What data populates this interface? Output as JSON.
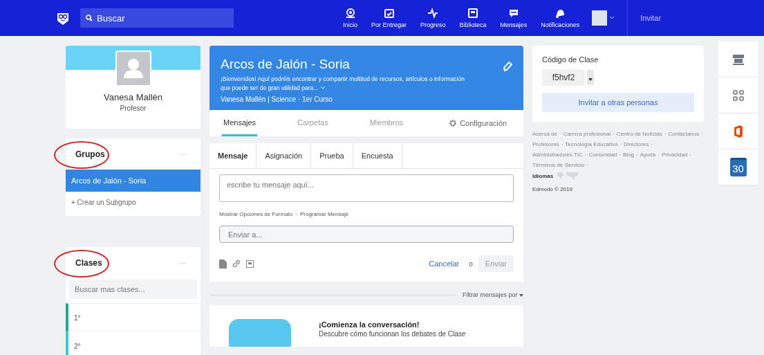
{
  "topbar": {
    "search_placeholder": "Buscar",
    "nav": [
      {
        "label": "Inicio"
      },
      {
        "label": "Por Entregar"
      },
      {
        "label": "Progreso"
      },
      {
        "label": "Biblioteca"
      },
      {
        "label": "Mensajes"
      },
      {
        "label": "Notificaciones"
      }
    ],
    "invite": "Invitar"
  },
  "profile": {
    "name": "Vanesa Mallén",
    "role": "Profesor"
  },
  "groups": {
    "title": "Grupos",
    "more": "···",
    "items": [
      {
        "label": "Arcos de Jalón - Soria",
        "selected": true
      }
    ],
    "create": "+ Crear un Subgrupo"
  },
  "classes": {
    "title": "Clases",
    "more": "···",
    "search_placeholder": "Buscar mas clases...",
    "items": [
      {
        "label": "1°",
        "color": "#2ba58a"
      },
      {
        "label": "2°",
        "color": "#3cc4dc"
      }
    ]
  },
  "group_header": {
    "title": "Arcos de Jalón - Soria",
    "description": "¡Bienvenidos! Aquí podréis encontrar y compartir multitud de recursos, artículos o información que puede ser de gran utilidad para...",
    "meta": "Vanesa Mallén | Science · 1er Curso"
  },
  "group_tabs": [
    {
      "label": "Mensajes",
      "selected": true
    },
    {
      "label": "Carpetas",
      "selected": false
    },
    {
      "label": "Miembros",
      "selected": false
    }
  ],
  "settings": "Configuración",
  "composer": {
    "tabs": [
      {
        "label": "Mensaje",
        "selected": true
      },
      {
        "label": "Asignación",
        "selected": false
      },
      {
        "label": "Prueba",
        "selected": false
      },
      {
        "label": "Encuesta",
        "selected": false
      }
    ],
    "message_placeholder": "escribe tu mensaje aquí...",
    "options": [
      "Mostrar Opciones de Formato",
      "Programar Mensaje"
    ],
    "separator": "·",
    "send_to_placeholder": "Enviar a...",
    "cancel": "Cancelar",
    "or": "o",
    "send": {
      "label": "Enviar",
      "disabled": true
    }
  },
  "filter": "Filtrar mensajes por",
  "empty_state": {
    "title": "¡Comienza la conversación!",
    "text": "Descubre cómo funcionan los debates de Clase"
  },
  "class_code": {
    "label": "Código de Clase",
    "code": "f5hvf2",
    "invite": "Invitar a otras personas"
  },
  "footer": {
    "separator": "·",
    "links": [
      "Acerca de",
      "Carrera profesional",
      "Centro de Noticias",
      "Contáctanos",
      "Profesores",
      "Tecnología Educativa",
      "Directores",
      "Administradores TIC",
      "Comunidad",
      "Blog",
      "Ayuda",
      "Privacidad",
      "Términos de Servicio"
    ],
    "languages": "Idiomas",
    "copyright": "Edmodo © 2019"
  },
  "apps": [
    {
      "kind": "store"
    },
    {
      "kind": "grid"
    },
    {
      "kind": "office"
    },
    {
      "kind": "calendar",
      "label": "30"
    }
  ]
}
